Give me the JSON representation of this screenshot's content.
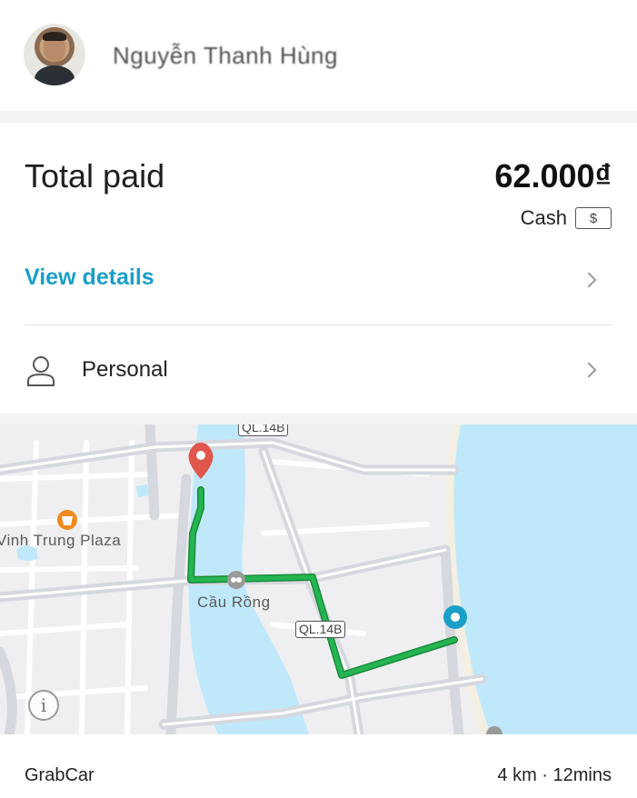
{
  "driver": {
    "name": "Nguyễn Thanh Hùng"
  },
  "payment": {
    "total_label": "Total paid",
    "total_amount": "62.000₫",
    "method_label": "Cash",
    "method_icon": "$",
    "view_details_label": "View details"
  },
  "profile": {
    "label": "Personal"
  },
  "map": {
    "labels": {
      "plaza": "Vinh Trung Plaza",
      "bridge": "Cầu Rồng",
      "road_top": "QL.14B",
      "road_mid": "QL.14B"
    },
    "colors": {
      "water": "#bfe9fb",
      "route": "#1fa84a",
      "pickup": "#1a9fc8",
      "dropoff": "#e0564a"
    }
  },
  "trip": {
    "service": "GrabCar",
    "distance_duration": "4 km · 12mins"
  },
  "colors": {
    "accent": "#1a9fc8"
  }
}
